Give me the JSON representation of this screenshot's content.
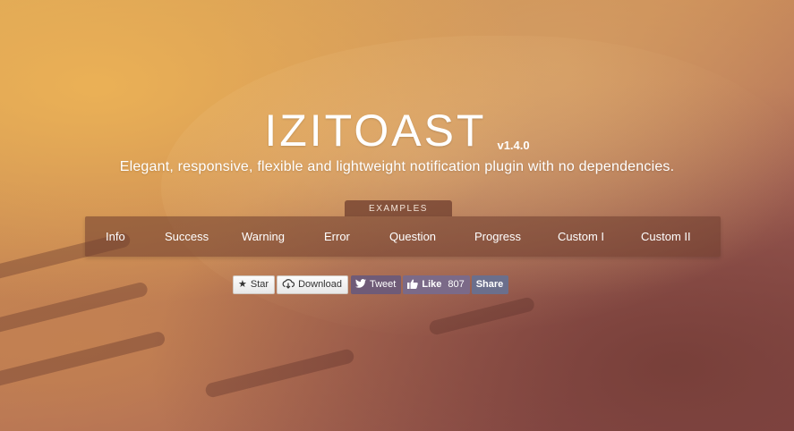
{
  "header": {
    "title": "IZITOAST",
    "version": "v1.4.0",
    "subtitle": "Elegant, responsive, flexible and lightweight notification plugin with no dependencies."
  },
  "examples": {
    "tab_label": "EXAMPLES",
    "items": [
      {
        "label": "Info"
      },
      {
        "label": "Success"
      },
      {
        "label": "Warning"
      },
      {
        "label": "Error"
      },
      {
        "label": "Question"
      },
      {
        "label": "Progress"
      },
      {
        "label": "Custom I"
      },
      {
        "label": "Custom II"
      }
    ]
  },
  "social": {
    "star_label": "Star",
    "star_icon": "star-icon",
    "download_label": "Download",
    "download_icon": "cloud-download-icon",
    "tweet_label": "Tweet",
    "tweet_icon": "bird-icon",
    "like_label": "Like",
    "like_count": "807",
    "like_icon": "thumbs-up-icon",
    "share_label": "Share"
  },
  "colors": {
    "bar": "#6e3c2d",
    "twitter": "#6f5b77",
    "facebook": "#7b6a88"
  }
}
